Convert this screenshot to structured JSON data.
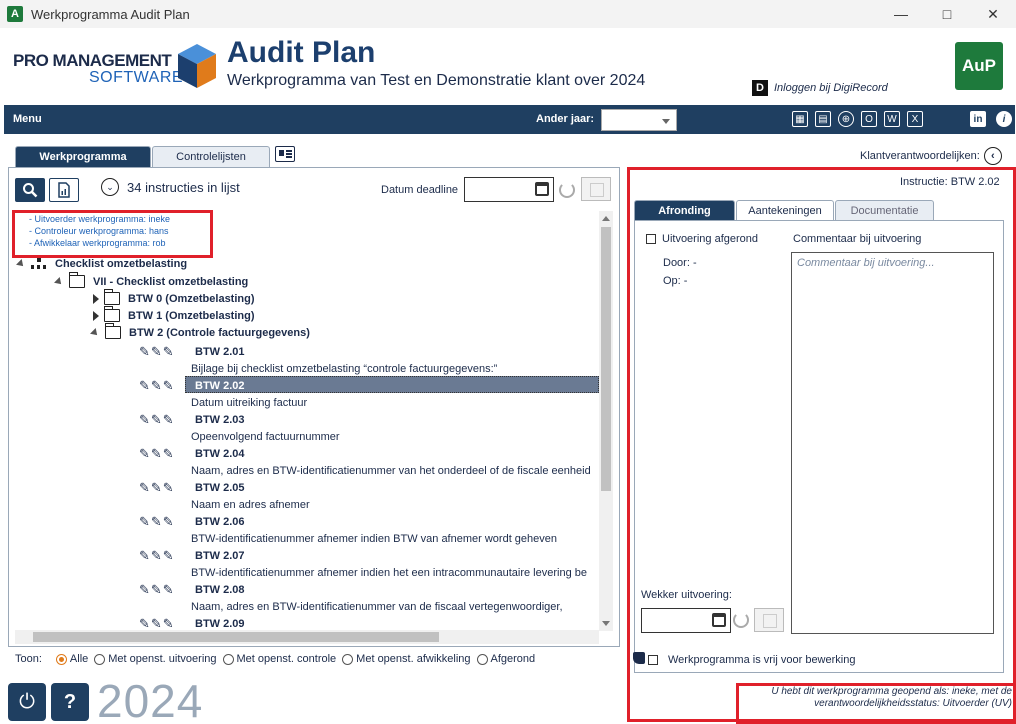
{
  "window": {
    "title": "Werkprogramma Audit Plan",
    "app_icon": "A"
  },
  "header": {
    "logo_line1": "PRO MANAGEMENT",
    "logo_line2": "SOFTWARE",
    "app_title": "Audit Plan",
    "subtitle": "Werkprogramma van Test en Demonstratie klant over 2024",
    "digirecord_badge": "D",
    "digirecord_link": "Inloggen bij DigiRecord",
    "aup_badge": "AuP"
  },
  "menubar": {
    "menu_label": "Menu",
    "year_label": "Ander jaar:",
    "year_value": ""
  },
  "tabs": {
    "werkprogramma": "Werkprogramma",
    "controlelijsten": "Controlelijsten"
  },
  "klant_label": "Klantverantwoordelijken:",
  "left": {
    "count_text": "34 instructies in lijst",
    "deadline_label": "Datum deadline",
    "info_lines": [
      "- Uitvoerder werkprogramma: ineke",
      "- Controleur werkprogramma: hans",
      "- Afwikkelaar werkprogramma: rob"
    ],
    "tree": {
      "root": "Checklist omzetbelasting",
      "level1": "VII - Checklist omzetbelasting",
      "folders": [
        "BTW 0  (Omzetbelasting)",
        "BTW 1  (Omzetbelasting)",
        "BTW 2  (Controle factuurgegevens)"
      ],
      "items": [
        {
          "code": "BTW 2.01",
          "desc": "Bijlage bij checklist omzetbelasting “controle factuurgegevens:”"
        },
        {
          "code": "BTW 2.02",
          "desc": "Datum uitreiking factuur"
        },
        {
          "code": "BTW 2.03",
          "desc": "Opeenvolgend factuurnummer"
        },
        {
          "code": "BTW 2.04",
          "desc": "Naam, adres en BTW-identificatienummer van het onderdeel of de fiscale eenheid"
        },
        {
          "code": "BTW 2.05",
          "desc": "Naam en adres afnemer"
        },
        {
          "code": "BTW 2.06",
          "desc": "BTW-identificatienummer afnemer indien BTW van afnemer wordt geheven"
        },
        {
          "code": "BTW 2.07",
          "desc": "BTW-identificatienummer afnemer indien het een intracommunautaire levering be"
        },
        {
          "code": "BTW 2.08",
          "desc": "Naam, adres en BTW-identificatienummer van de fiscaal vertegenwoordiger,"
        },
        {
          "code": "BTW 2.09",
          "desc": ""
        }
      ]
    },
    "toon_label": "Toon:",
    "filters": [
      "Alle",
      "Met openst. uitvoering",
      "Met openst. controle",
      "Met openst. afwikkeling",
      "Afgerond"
    ],
    "selected_filter": "Alle"
  },
  "right": {
    "instructie": "Instructie: BTW 2.02",
    "tabs": [
      "Afronding",
      "Aantekeningen",
      "Documentatie"
    ],
    "uitvoering_afgerond": "Uitvoering afgerond",
    "door": "Door: -",
    "op": "Op: -",
    "comment_label": "Commentaar bij uitvoering",
    "comment_placeholder": "Commentaar bij uitvoering...",
    "wekker_label": "Wekker uitvoering:",
    "vrij_label": "Werkprogramma is vrij voor bewerking",
    "status_line1": "U hebt dit werkprogramma geopend als: ineke, met de",
    "status_line2": "verantwoordelijkheidsstatus: Uitvoerder (UV)"
  },
  "footer": {
    "year": "2024"
  },
  "colors": {
    "navy": "#1f3f61",
    "red": "#e0202a",
    "green": "#1e7a3c",
    "orange": "#e07b1b"
  }
}
